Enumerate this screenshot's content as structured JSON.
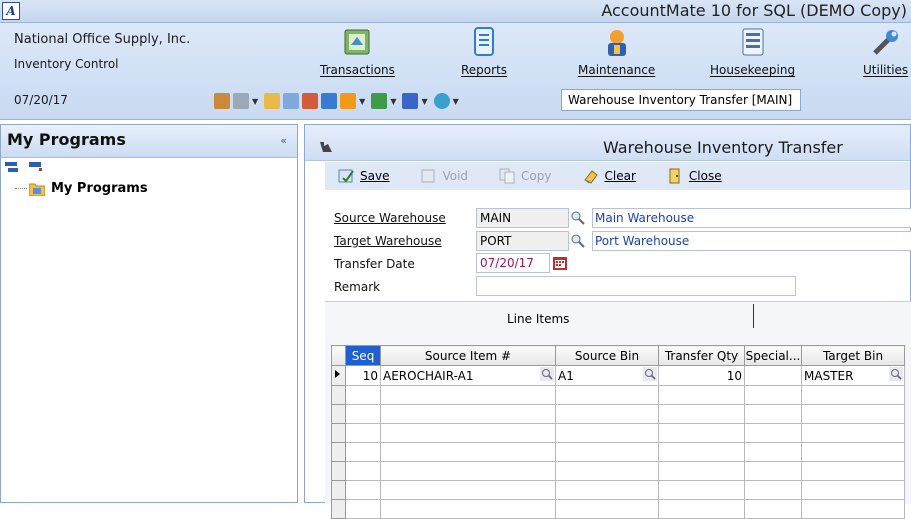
{
  "app": {
    "title": "AccountMate 10 for SQL (DEMO Copy)"
  },
  "header": {
    "company": "National Office Supply, Inc.",
    "module": "Inventory Control",
    "date": "07/20/17",
    "menu": [
      {
        "label": "Transactions",
        "icon": "transactions-icon"
      },
      {
        "label": "Reports",
        "icon": "reports-icon"
      },
      {
        "label": "Maintenance",
        "icon": "maintenance-icon"
      },
      {
        "label": "Housekeeping",
        "icon": "housekeeping-icon"
      },
      {
        "label": "Utilities",
        "icon": "utilities-icon"
      }
    ],
    "window_combo": "Warehouse Inventory Transfer [MAIN]"
  },
  "left_panel": {
    "title": "My Programs",
    "collapse_glyph": "«",
    "tree_item": "My Programs"
  },
  "form": {
    "title": "Warehouse Inventory Transfer",
    "actions": [
      {
        "label": "Save",
        "enabled": true
      },
      {
        "label": "Void",
        "enabled": false
      },
      {
        "label": "Copy",
        "enabled": false
      },
      {
        "label": "Clear",
        "enabled": true
      },
      {
        "label": "Close",
        "enabled": true
      }
    ],
    "source_warehouse": {
      "label": "Source Warehouse",
      "code": "MAIN",
      "desc": "Main Warehouse"
    },
    "target_warehouse": {
      "label": "Target Warehouse",
      "code": "PORT",
      "desc": "Port Warehouse"
    },
    "transfer_date": {
      "label": "Transfer Date",
      "value": "07/20/17"
    },
    "remark": {
      "label": "Remark",
      "value": ""
    },
    "tab": "Line Items",
    "grid": {
      "columns": [
        "Seq",
        "Source Item #",
        "Source Bin",
        "Transfer Qty",
        "Special...",
        "Target Bin"
      ],
      "rows": [
        [
          "10",
          "AEROCHAIR-A1",
          "A1",
          "10",
          "",
          "MASTER"
        ]
      ]
    }
  },
  "colors": {
    "accent": "#1f5fd0",
    "link": "#1b3fb0",
    "date": "#a0145a"
  }
}
